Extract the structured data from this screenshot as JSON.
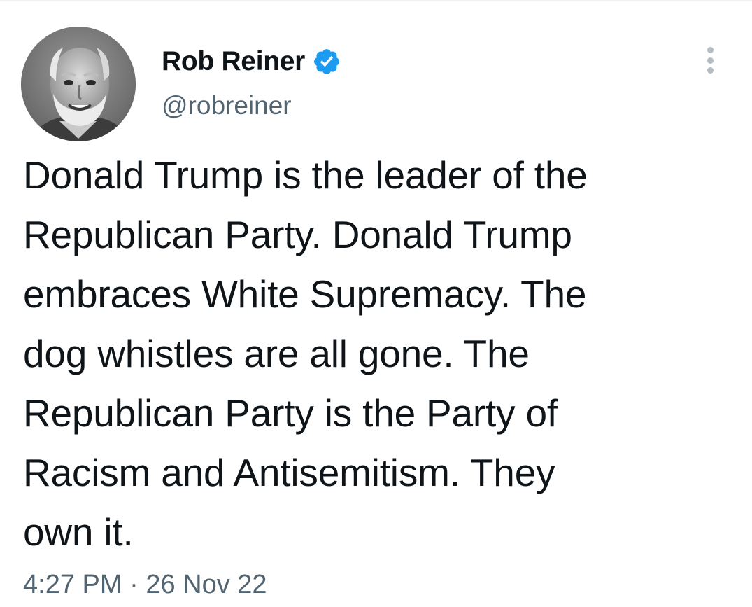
{
  "author": {
    "display_name": "Rob Reiner",
    "handle": "@robreiner",
    "verified": true,
    "verified_color": "#1d9bf0",
    "avatar_icon": "profile-photo"
  },
  "more_icon": "more-vertical-icon",
  "tweet": {
    "lines": [
      "Donald Trump is the leader of the",
      "Republican Party. Donald Trump",
      "embraces White Supremacy. The",
      "dog whistles are all gone. The",
      "Republican Party is the Party of",
      "Racism and Antisemitism. They",
      "own it."
    ]
  },
  "meta": {
    "time": "4:27 PM",
    "separator": "·",
    "date": "26 Nov 22"
  },
  "colors": {
    "text": "#0f1419",
    "secondary_text": "#536471",
    "background": "#ffffff"
  }
}
